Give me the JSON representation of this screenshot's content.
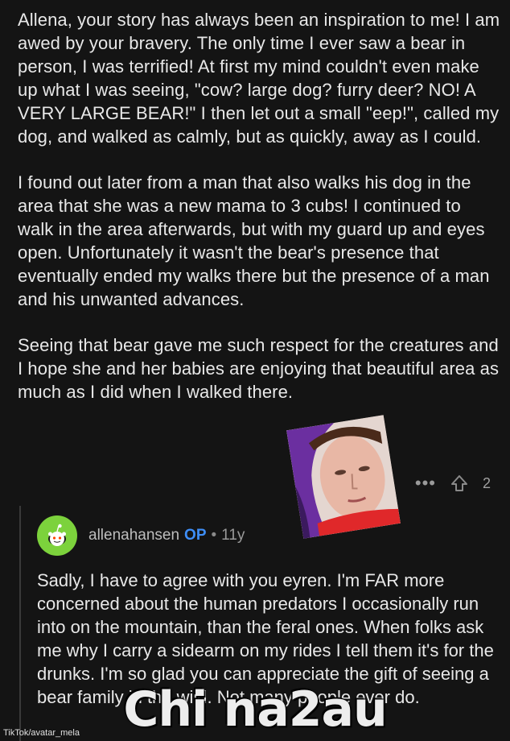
{
  "comment": {
    "paragraphs": [
      "Allena, your story has always been an inspiration to me! I am awed by your bravery. The only time I ever saw a bear in person, I was terrified! At first my mind couldn't even make up what I was seeing, \"cow? large dog? furry deer? NO! A VERY LARGE BEAR!\" I then let out a small \"eep!\", called my dog, and walked as calmly, but as quickly, away as I could.",
      "I found out later from a man that also walks his dog in the area that she was a new mama to 3 cubs! I continued to walk in the area afterwards, but with my guard up and eyes open. Unfortunately it wasn't the bear's presence that eventually ended my walks there but the presence of a man and his unwanted advances.",
      "Seeing that bear gave me such respect for the creatures and I hope she and her babies are enjoying that beautiful area as much as I did when I walked there."
    ],
    "more_label": "•••",
    "upvote_icon": "upvote-arrow-icon",
    "vote_count": "2"
  },
  "reply": {
    "avatar_icon": "reddit-snoo-avatar-icon",
    "username": "allenahansen",
    "op_badge": "OP",
    "dot": "•",
    "age": "11y",
    "body": "Sadly, I have to agree with you eyren.  I'm FAR more concerned about the human predators I occasionally run into on the mountain, than the feral ones. When folks ask me why I carry a sidearm on my rides I tell them it's for the drunks. I'm so glad you can appreciate the gift of seeing a bear family in the wild. Not many people ever do."
  },
  "overlay": {
    "watermark": "Chi na2au",
    "credit": "TikTok/avatar_mela"
  },
  "colors": {
    "background": "#141414",
    "text": "#e8e8e8",
    "op_blue": "#3e8ef7",
    "avatar_green": "#7cd23c"
  }
}
